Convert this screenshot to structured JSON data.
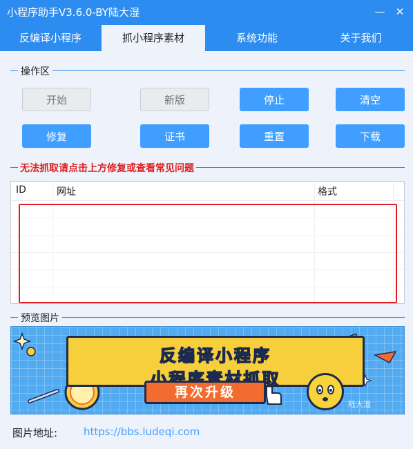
{
  "window": {
    "title": "小程序助手V3.6.0-BY陆大湿",
    "minimize_icon": "minimize-icon",
    "close_icon": "close-icon"
  },
  "tabs": [
    {
      "label": "反编译小程序",
      "active": false
    },
    {
      "label": "抓小程序素材",
      "active": true
    },
    {
      "label": "系统功能",
      "active": false
    },
    {
      "label": "关于我们",
      "active": false
    }
  ],
  "operation_area": {
    "label": "操作区",
    "buttons": {
      "start": "开始",
      "new_version": "新版",
      "stop": "停止",
      "clear": "清空",
      "repair": "修复",
      "certificate": "证书",
      "reset": "重置",
      "download": "下载"
    }
  },
  "warning_text": "无法抓取请点击上方修复或查看常见问题",
  "table": {
    "columns": [
      "ID",
      "网址",
      "格式"
    ],
    "rows": []
  },
  "preview": {
    "label": "预览图片",
    "banner": {
      "line1": "反编译小程序",
      "line2": "小程序素材抓取",
      "pill": "再次升级",
      "watermark": "陆大湿"
    }
  },
  "image_address": {
    "label": "图片地址:",
    "url": "https://bbs.ludeqi.com"
  },
  "colors": {
    "accent": "#2d8cf0",
    "button_blue": "#409eff",
    "warning": "#e02020",
    "highlight_box": "#e51c23"
  }
}
